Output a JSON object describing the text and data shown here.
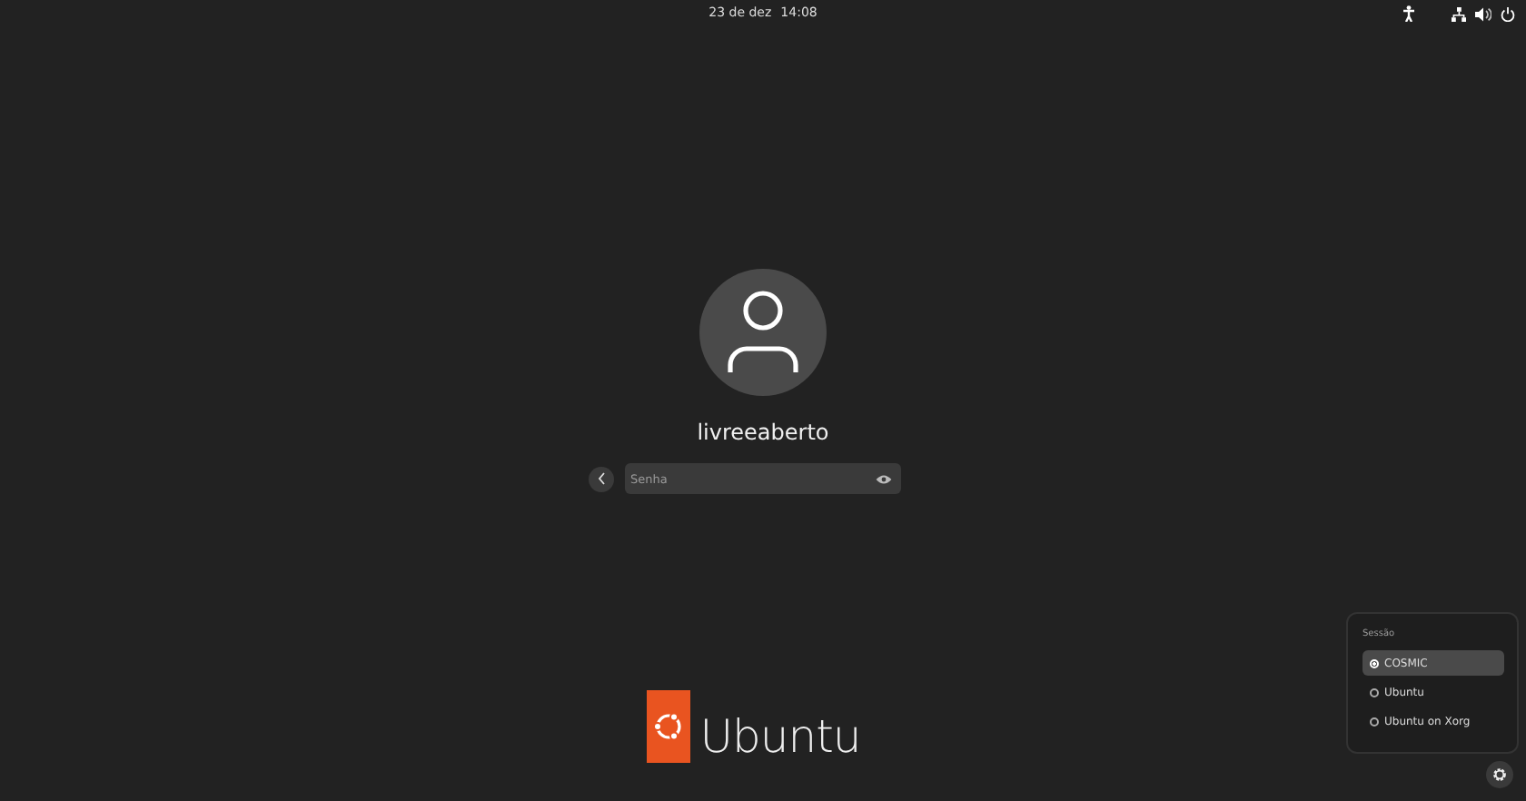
{
  "top_bar": {
    "date": "23 de dez",
    "time": "14:08"
  },
  "user": {
    "name": "livreeaberto"
  },
  "password": {
    "placeholder": "Senha"
  },
  "logo": {
    "text": "Ubuntu"
  },
  "session_menu": {
    "title": "Sessão",
    "options": [
      {
        "label": "COSMIC",
        "selected": true
      },
      {
        "label": "Ubuntu",
        "selected": false
      },
      {
        "label": "Ubuntu on Xorg",
        "selected": false
      }
    ]
  }
}
